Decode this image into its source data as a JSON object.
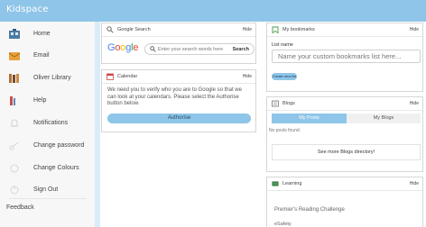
{
  "app": {
    "title": "Kidspace"
  },
  "sidebar": {
    "items": [
      {
        "label": "Home",
        "icon": "home-icon"
      },
      {
        "label": "Email",
        "icon": "email-icon"
      },
      {
        "label": "Oliver Library",
        "icon": "library-icon"
      },
      {
        "label": "Help",
        "icon": "help-icon"
      },
      {
        "label": "Notifications",
        "icon": "bell-icon"
      },
      {
        "label": "Change password",
        "icon": "key-icon"
      },
      {
        "label": "Change Colours",
        "icon": "palette-icon"
      },
      {
        "label": "Sign Out",
        "icon": "power-icon"
      }
    ],
    "feedback": "Feedback"
  },
  "google_search": {
    "title": "Google Search",
    "hide": "Hide",
    "logo": "Google",
    "placeholder": "Enter your search words here",
    "search_label": "Search"
  },
  "calendar": {
    "title": "Calendar",
    "hide": "Hide",
    "message": "We need you to verify who you are to Google so that we can look at your calendars. Please select the Authorise button below.",
    "authorise_label": "Authorise"
  },
  "bookmarks": {
    "title": "My bookmarks",
    "hide": "Hide",
    "list_name_label": "List name",
    "list_name_placeholder": "Name your custom bookmarks list here...",
    "create_label": "Create new list"
  },
  "blogs": {
    "title": "Blogs",
    "hide": "Hide",
    "tabs": [
      "My Posts",
      "My Blogs"
    ],
    "no_posts": "No posts found.",
    "directory_link": "See more Blogs directory!"
  },
  "learning": {
    "title": "Learning",
    "hide": "Hide",
    "items": [
      "Premier's Reading Challenge",
      "eSafety"
    ]
  },
  "colors": {
    "accent": "#8ec5e8",
    "sidebar_bg": "#f7f7f7",
    "email_icon": "#e8a23a",
    "library_icon": "#b0703a",
    "home_icon": "#4a7aa3"
  }
}
